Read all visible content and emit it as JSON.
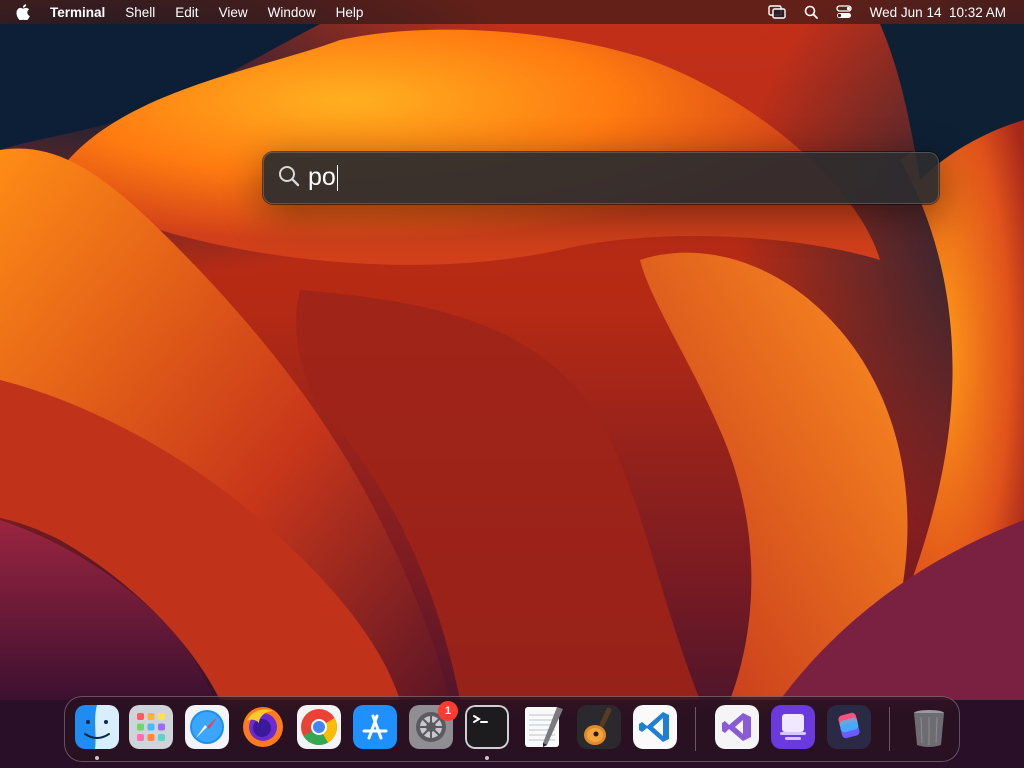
{
  "menubar": {
    "apple_icon": "apple-logo",
    "app_name": "Terminal",
    "menus": [
      "Shell",
      "Edit",
      "View",
      "Window",
      "Help"
    ],
    "status_icons": [
      "screen-mirroring-icon",
      "spotlight-search-icon",
      "control-center-icon"
    ],
    "clock": "Wed Jun 14  10:32 AM"
  },
  "spotlight": {
    "icon": "search-icon",
    "query": "po"
  },
  "dock": {
    "apps": [
      {
        "name": "Finder",
        "icon": "finder-icon",
        "running": true
      },
      {
        "name": "Launchpad",
        "icon": "launchpad-icon",
        "running": false
      },
      {
        "name": "Safari",
        "icon": "safari-icon",
        "running": false
      },
      {
        "name": "Firefox",
        "icon": "firefox-icon",
        "running": false
      },
      {
        "name": "Google Chrome",
        "icon": "chrome-icon",
        "running": false
      },
      {
        "name": "App Store",
        "icon": "app-store-icon",
        "running": false
      },
      {
        "name": "System Preferences",
        "icon": "system-preferences-icon",
        "running": false,
        "badge": "1"
      },
      {
        "name": "Terminal",
        "icon": "terminal-icon",
        "running": true
      },
      {
        "name": "TextEdit",
        "icon": "textedit-icon",
        "running": false
      },
      {
        "name": "GarageBand",
        "icon": "garageband-icon",
        "running": false
      },
      {
        "name": "Visual Studio Code",
        "icon": "vscode-icon",
        "running": false
      },
      {
        "name": "Visual Studio",
        "icon": "visual-studio-icon",
        "running": false
      },
      {
        "name": "Apple Configurator",
        "icon": "configurator-icon",
        "running": false
      },
      {
        "name": "Shortcuts",
        "icon": "shortcuts-icon",
        "running": false
      },
      {
        "name": "Trash",
        "icon": "trash-icon",
        "running": false
      }
    ]
  },
  "colors": {
    "accent_orange": "#ff8a1a",
    "wallpaper_red": "#c3301a",
    "badge_red": "#ff3b30"
  }
}
